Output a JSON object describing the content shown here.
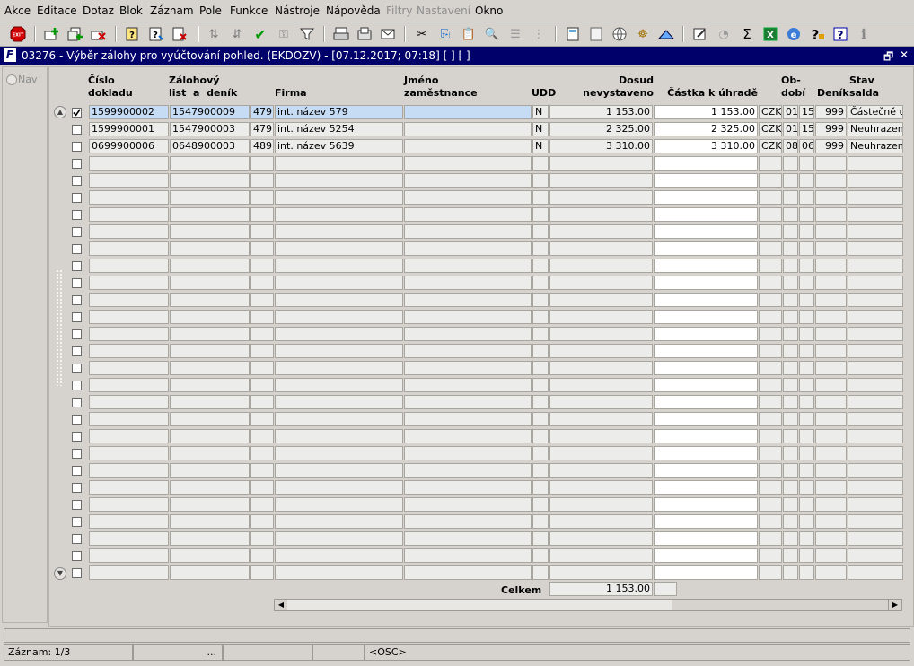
{
  "menu": [
    "Akce",
    "Editace",
    "Dotaz",
    "Blok",
    "Záznam",
    "Pole",
    "Funkce",
    "Nástroje",
    "Nápověda",
    "Filtry",
    "Nastavení",
    "Okno"
  ],
  "menu_disabled": [
    "Filtry",
    "Nastavení"
  ],
  "window": {
    "logo": "F",
    "title": "03276 - Výběr zálohy pro vyúčtování pohled. (EKDOZV) - [07.12.2017; 07:18]  [ ] [ ]",
    "restore": "🗗",
    "close": "✕"
  },
  "nav": {
    "label": "Nav"
  },
  "columns": {
    "cislo_dokladu": [
      "Číslo",
      "dokladu"
    ],
    "zalohovy_list": [
      "Zálohový",
      "list  a  deník"
    ],
    "firma": "Firma",
    "jmeno": [
      "Jméno",
      "zaměstnance"
    ],
    "udd": "UDD",
    "dosud": [
      "Dosud",
      "nevystaveno"
    ],
    "castka": "Částka k úhradě",
    "obdobi": [
      "Ob-",
      "dobí"
    ],
    "denik": "Deník",
    "stav": [
      "Stav",
      "salda"
    ]
  },
  "rows": [
    {
      "checked": true,
      "cislo": "1599900002",
      "zal": "1547900009",
      "fnum": "479",
      "firma": "int. název 579",
      "jmeno": "",
      "udd": "N",
      "dosud": "1 153.00",
      "castka": "1 153.00",
      "mena": "CZK",
      "ob1": "01",
      "ob2": "15",
      "denik": "999",
      "stav": "Částečně uh"
    },
    {
      "checked": false,
      "cislo": "1599900001",
      "zal": "1547900003",
      "fnum": "479",
      "firma": "int. název 5254",
      "jmeno": "",
      "udd": "N",
      "dosud": "2 325.00",
      "castka": "2 325.00",
      "mena": "CZK",
      "ob1": "01",
      "ob2": "15",
      "denik": "999",
      "stav": "Neuhrazené"
    },
    {
      "checked": false,
      "cislo": "0699900006",
      "zal": "0648900003",
      "fnum": "489",
      "firma": "int. název 5639",
      "jmeno": "",
      "udd": "N",
      "dosud": "3 310.00",
      "castka": "3 310.00",
      "mena": "CZK",
      "ob1": "08",
      "ob2": "06",
      "denik": "999",
      "stav": "Neuhrazené"
    }
  ],
  "total_rows": 28,
  "total": {
    "label": "Celkem",
    "value": "1 153.00"
  },
  "status": {
    "record": "Záznam: 1/3",
    "dots": "...",
    "osc": "<OSC>"
  },
  "colors": {
    "title_bg": "#00006b",
    "selected": "#c6dcf4",
    "panel": "#d6d3ce"
  }
}
